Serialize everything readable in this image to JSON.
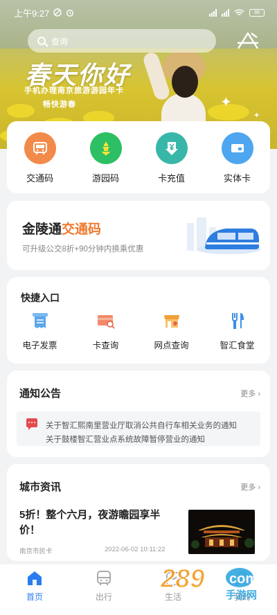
{
  "status_bar": {
    "time": "上午9:27",
    "battery": "88"
  },
  "hero": {
    "search_placeholder": "查询",
    "title": "春天你好",
    "subtitle_line1": "手机办理南京旅游游园年卡",
    "subtitle_line2": "畅快游春"
  },
  "quick_actions": [
    {
      "label": "交通码",
      "icon": "bus-card-icon",
      "color": "#f28a4a"
    },
    {
      "label": "游园码",
      "icon": "tower-icon",
      "color": "#2dbf63"
    },
    {
      "label": "卡充值",
      "icon": "yuan-download-icon",
      "color": "#38b7a8"
    },
    {
      "label": "实体卡",
      "icon": "card-icon",
      "color": "#4ea5f0"
    }
  ],
  "jinlingtong": {
    "title_prefix": "金陵通",
    "title_highlight": "交通码",
    "subtitle": "可升级公交8折+90分钟内换乘优惠"
  },
  "shortcuts": {
    "title": "快捷入口",
    "items": [
      {
        "label": "电子发票",
        "icon": "invoice-icon"
      },
      {
        "label": "卡查询",
        "icon": "card-search-icon"
      },
      {
        "label": "网点查询",
        "icon": "store-location-icon"
      },
      {
        "label": "智汇食堂",
        "icon": "fork-knife-icon"
      }
    ]
  },
  "notice": {
    "title": "通知公告",
    "more": "更多",
    "line1": "关于智汇熙南里营业厅取消公共自行车相关业务的通知",
    "line2": "关于鼓楼智汇营业点系统故障暂停营业的通知"
  },
  "news": {
    "title": "城市资讯",
    "more": "更多",
    "headline": "5折！整个六月，夜游瞻园享半价！",
    "source": "南京市民卡",
    "date": "2022-06-02 10:11:22"
  },
  "tabs": [
    {
      "label": "首页",
      "icon": "home-icon",
      "active": true
    },
    {
      "label": "出行",
      "icon": "bus-icon",
      "active": false
    },
    {
      "label": "生活",
      "icon": "life-icon",
      "active": false
    },
    {
      "label": "我的",
      "icon": "user-icon",
      "active": false
    }
  ],
  "watermark": {
    "text": "289",
    "suffix": "手游网"
  },
  "colors": {
    "accent": "#2b7cf0",
    "highlight": "#f0792f"
  }
}
